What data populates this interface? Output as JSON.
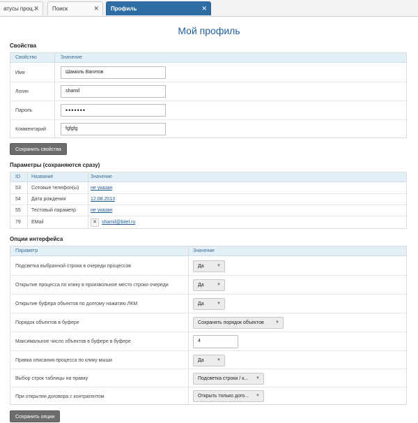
{
  "tabs": [
    {
      "label": "атусы проц...",
      "close": "✕"
    },
    {
      "label": "Поиск",
      "close": "✕"
    },
    {
      "label": "Профиль",
      "close": "✕"
    }
  ],
  "page_title": "Мой профиль",
  "properties": {
    "title": "Свойства",
    "col_property": "Свойство",
    "col_value": "Значение",
    "rows": [
      {
        "label": "Имя",
        "value": "Шамиль Вагитов"
      },
      {
        "label": "Логин",
        "value": "shamil"
      },
      {
        "label": "Пароль",
        "value": "•••••••"
      },
      {
        "label": "Комментарий",
        "value": "fgfgfg"
      }
    ],
    "save_label": "Сохранить свойства"
  },
  "params": {
    "title": "Параметры (сохраняются сразу)",
    "col_id": "ID",
    "col_name": "Название",
    "col_value": "Значение",
    "rows": [
      {
        "id": "53",
        "name": "Сотовые телефон(ы)",
        "value": "не указан"
      },
      {
        "id": "54",
        "name": "Дата рождения",
        "value": "12.08.2013"
      },
      {
        "id": "55",
        "name": "Тестовый параметр",
        "value": "не указан"
      },
      {
        "id": "79",
        "name": "EMail",
        "clear": "✕",
        "value": "shamil@bitel.ru"
      }
    ]
  },
  "options": {
    "title": "Опции интерфейса",
    "col_param": "Параметр",
    "col_value": "Значение",
    "rows": [
      {
        "label": "Подсветка выбранной строки в очереди процессов",
        "value": "Да"
      },
      {
        "label": "Открытие процесса по клику в произвольное место строки очереди",
        "value": "Да"
      },
      {
        "label": "Открытие буфера объектов по долгому нажатию ЛКМ",
        "value": "Да"
      },
      {
        "label": "Порядок объектов в буфере",
        "value": "Сохранять порядок объектов"
      },
      {
        "label": "Максимальное число объектов в буфере в буфере",
        "value": "4"
      },
      {
        "label": "Правка описания процесса по клику мыши",
        "value": "Да"
      },
      {
        "label": "Выбор строк таблицы на правку",
        "value": "Подсветка строки / к..."
      },
      {
        "label": "При открытии договора с контрагентом",
        "value": "Открыть только дого..."
      }
    ],
    "save_label": "Сохранить опции"
  }
}
